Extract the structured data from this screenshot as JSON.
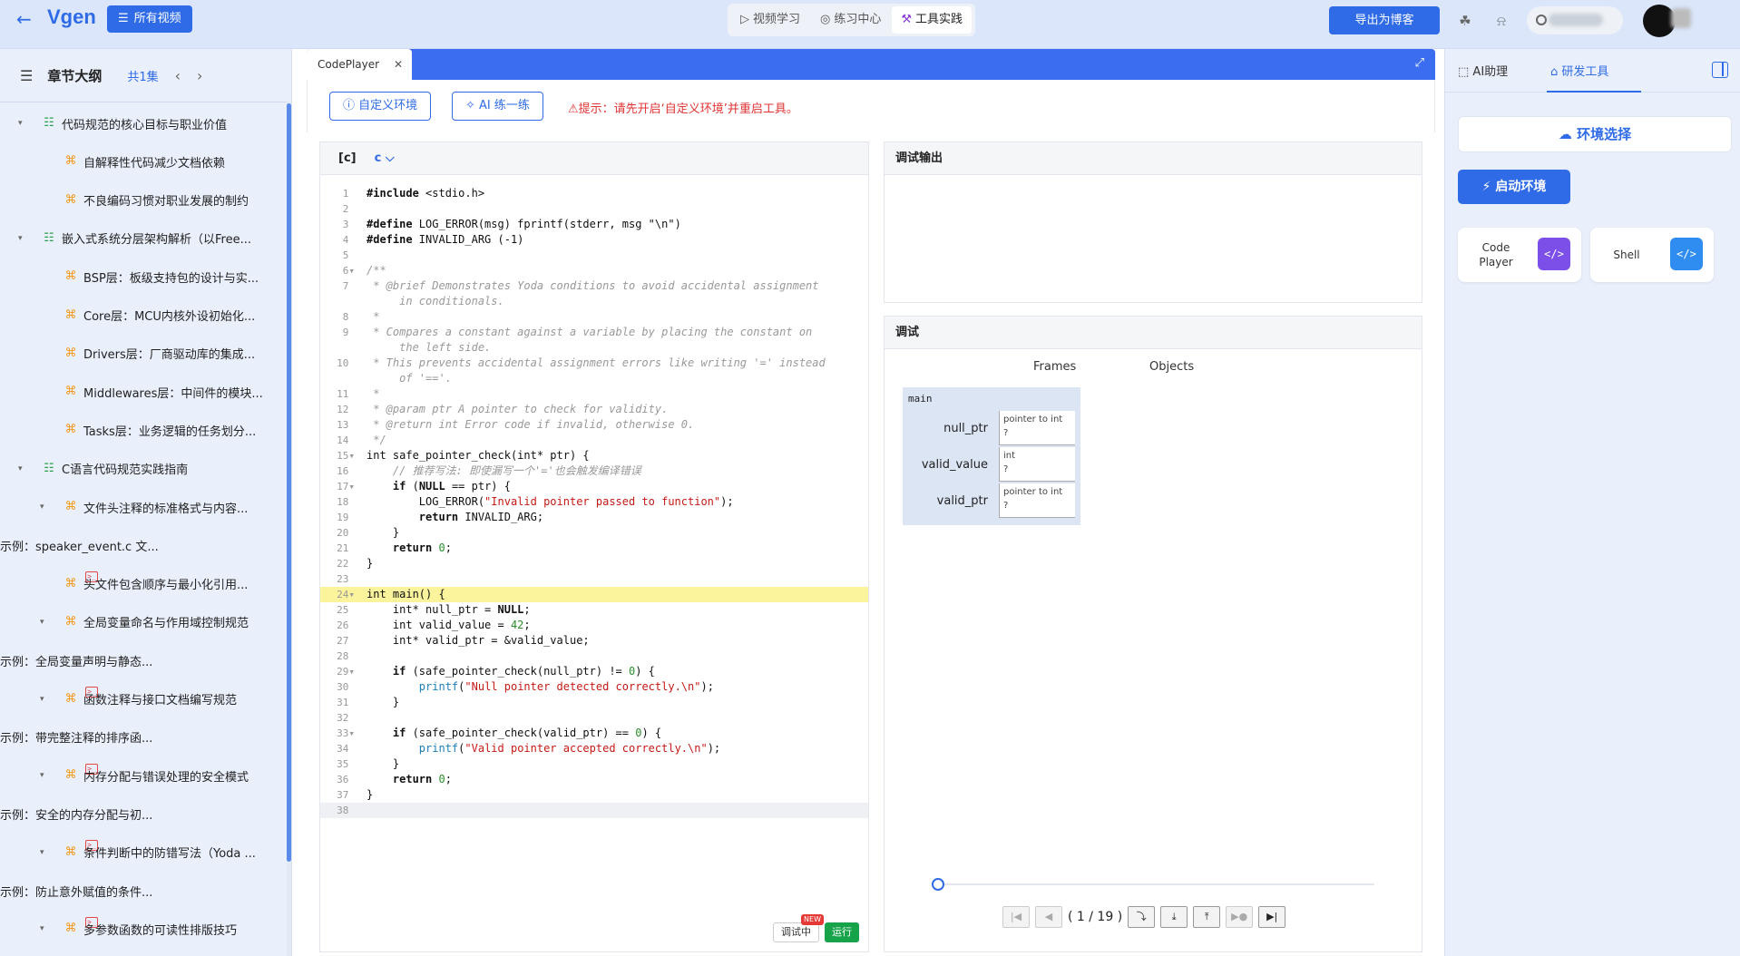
{
  "header": {
    "back_icon": "arrow-left-icon",
    "brand": "Vgen",
    "all_videos": "所有视频",
    "tabs": [
      {
        "label": "视频学习",
        "icon": "play-icon"
      },
      {
        "label": "练习中心",
        "icon": "target-icon"
      },
      {
        "label": "工具实践",
        "icon": "wrench-icon"
      }
    ],
    "active_tab": "工具实践",
    "export": "导出为博客"
  },
  "sidebar": {
    "title": "章节大纲",
    "count": "共1集",
    "items": [
      {
        "label": "代码规范的核心目标与职业价值",
        "level": 0,
        "icon": "tree-icon",
        "caret": true
      },
      {
        "label": "自解释性代码减少文档依赖",
        "level": 1,
        "icon": "hierarchy-icon",
        "caret": false
      },
      {
        "label": "不良编码习惯对职业发展的制约",
        "level": 1,
        "icon": "hierarchy-icon",
        "caret": false
      },
      {
        "label": "嵌入式系统分层架构解析（以Free...",
        "level": 0,
        "icon": "tree-icon",
        "caret": true
      },
      {
        "label": "BSP层：板级支持包的设计与实...",
        "level": 1,
        "icon": "hierarchy-icon",
        "caret": false
      },
      {
        "label": "Core层：MCU内核外设初始化...",
        "level": 1,
        "icon": "hierarchy-icon",
        "caret": false
      },
      {
        "label": "Drivers层：厂商驱动库的集成...",
        "level": 1,
        "icon": "hierarchy-icon",
        "caret": false
      },
      {
        "label": "Middlewares层：中间件的模块...",
        "level": 1,
        "icon": "hierarchy-icon",
        "caret": false
      },
      {
        "label": "Tasks层：业务逻辑的任务划分...",
        "level": 1,
        "icon": "hierarchy-icon",
        "caret": false
      },
      {
        "label": "C语言代码规范实践指南",
        "level": 0,
        "icon": "tree-icon",
        "caret": true
      },
      {
        "label": "文件头注释的标准格式与内容...",
        "level": 1,
        "icon": "hierarchy-icon",
        "caret": true
      },
      {
        "label": "示例：speaker_event.c 文...",
        "level": 2,
        "icon": "code-icon",
        "caret": false
      },
      {
        "label": "头文件包含顺序与最小化引用...",
        "level": 1,
        "icon": "hierarchy-icon",
        "caret": false
      },
      {
        "label": "全局变量命名与作用域控制规范",
        "level": 1,
        "icon": "hierarchy-icon",
        "caret": true
      },
      {
        "label": "示例：全局变量声明与静态...",
        "level": 2,
        "icon": "code-icon",
        "caret": false
      },
      {
        "label": "函数注释与接口文档编写规范",
        "level": 1,
        "icon": "hierarchy-icon",
        "caret": true
      },
      {
        "label": "示例：带完整注释的排序函...",
        "level": 2,
        "icon": "code-icon",
        "caret": false
      },
      {
        "label": "内存分配与错误处理的安全模式",
        "level": 1,
        "icon": "hierarchy-icon",
        "caret": true
      },
      {
        "label": "示例：安全的内存分配与初...",
        "level": 2,
        "icon": "code-icon",
        "caret": false
      },
      {
        "label": "条件判断中的防错写法（Yoda ...",
        "level": 1,
        "icon": "hierarchy-icon",
        "caret": true
      },
      {
        "label": "示例：防止意外赋值的条件...",
        "level": 2,
        "icon": "code-icon",
        "caret": false
      },
      {
        "label": "多参数函数的可读性排版技巧",
        "level": 1,
        "icon": "hierarchy-icon",
        "caret": true
      }
    ]
  },
  "codeplayer": {
    "tab_label": "CodePlayer",
    "custom_env": "自定义环境",
    "ai_practice": "AI 练一练",
    "warning": "提示：请先开启‘自定义环境’并重启工具。",
    "lang_tag": "[c]",
    "lang": "c",
    "debug_label": "调试中",
    "new_badge": "NEW",
    "run_label": "运行",
    "highlight_line": 24,
    "lines": [
      {
        "n": 1,
        "t": "#include <stdio.h>"
      },
      {
        "n": 2,
        "t": ""
      },
      {
        "n": 3,
        "t": "#define LOG_ERROR(msg) fprintf(stderr, msg \"\\n\")"
      },
      {
        "n": 4,
        "t": "#define INVALID_ARG (-1)"
      },
      {
        "n": 5,
        "t": ""
      },
      {
        "n": 6,
        "t": "/**",
        "fold": true
      },
      {
        "n": 7,
        "t": " * @brief Demonstrates Yoda conditions to avoid accidental assignment"
      },
      {
        "n": null,
        "t": "     in conditionals."
      },
      {
        "n": 8,
        "t": " *"
      },
      {
        "n": 9,
        "t": " * Compares a constant against a variable by placing the constant on"
      },
      {
        "n": null,
        "t": "     the left side."
      },
      {
        "n": 10,
        "t": " * This prevents accidental assignment errors like writing '=' instead"
      },
      {
        "n": null,
        "t": "     of '=='."
      },
      {
        "n": 11,
        "t": " *"
      },
      {
        "n": 12,
        "t": " * @param ptr A pointer to check for validity."
      },
      {
        "n": 13,
        "t": " * @return int Error code if invalid, otherwise 0."
      },
      {
        "n": 14,
        "t": " */"
      },
      {
        "n": 15,
        "t": "int safe_pointer_check(int* ptr) {",
        "fold": true
      },
      {
        "n": 16,
        "t": "    // 推荐写法: 即使漏写一个'='也会触发编译错误"
      },
      {
        "n": 17,
        "t": "    if (NULL == ptr) {",
        "fold": true
      },
      {
        "n": 18,
        "t": "        LOG_ERROR(\"Invalid pointer passed to function\");"
      },
      {
        "n": 19,
        "t": "        return INVALID_ARG;"
      },
      {
        "n": 20,
        "t": "    }"
      },
      {
        "n": 21,
        "t": "    return 0;"
      },
      {
        "n": 22,
        "t": "}"
      },
      {
        "n": 23,
        "t": ""
      },
      {
        "n": 24,
        "t": "int main() {",
        "fold": true
      },
      {
        "n": 25,
        "t": "    int* null_ptr = NULL;"
      },
      {
        "n": 26,
        "t": "    int valid_value = 42;"
      },
      {
        "n": 27,
        "t": "    int* valid_ptr = &valid_value;"
      },
      {
        "n": 28,
        "t": ""
      },
      {
        "n": 29,
        "t": "    if (safe_pointer_check(null_ptr) != 0) {",
        "fold": true
      },
      {
        "n": 30,
        "t": "        printf(\"Null pointer detected correctly.\\n\");"
      },
      {
        "n": 31,
        "t": "    }"
      },
      {
        "n": 32,
        "t": ""
      },
      {
        "n": 33,
        "t": "    if (safe_pointer_check(valid_ptr) == 0) {",
        "fold": true
      },
      {
        "n": 34,
        "t": "        printf(\"Valid pointer accepted correctly.\\n\");"
      },
      {
        "n": 35,
        "t": "    }"
      },
      {
        "n": 36,
        "t": "    return 0;"
      },
      {
        "n": 37,
        "t": "}"
      },
      {
        "n": 38,
        "t": ""
      }
    ]
  },
  "output": {
    "title": "调试输出"
  },
  "debugger": {
    "title": "调试",
    "frames_label": "Frames",
    "objects_label": "Objects",
    "frame_name": "main",
    "vars": [
      {
        "name": "null_ptr",
        "type": "pointer to int",
        "value": "?"
      },
      {
        "name": "valid_value",
        "type": "int",
        "value": "?"
      },
      {
        "name": "valid_ptr",
        "type": "pointer to int",
        "value": "?"
      }
    ],
    "step_counter": "( 1 / 19 )",
    "step_progress": 0.0
  },
  "right_panel": {
    "tabs": [
      {
        "label": "AI助理",
        "icon": "robot-icon"
      },
      {
        "label": "研发工具",
        "icon": "toolbox-icon"
      }
    ],
    "active": "研发工具",
    "env_select": "环境选择",
    "start_env": "启动环境",
    "cards": [
      {
        "label": "Code Player",
        "icon": "</>",
        "color": "#7b4fe8"
      },
      {
        "label": "Shell",
        "icon": "</>",
        "color": "#2f8cf0"
      }
    ]
  }
}
